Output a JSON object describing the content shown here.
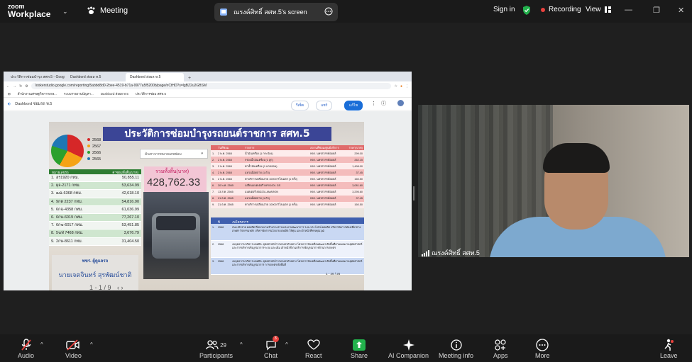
{
  "app": {
    "logo_line1": "zoom",
    "logo_line2": "Workplace",
    "meeting_label": "Meeting",
    "screen_tab_title": "ณรงค์ศิทธิ์ สศท.5's screen",
    "sign_in": "Sign in",
    "recording": "Recording",
    "view": "View"
  },
  "browser": {
    "tabs": [
      "ประวัติการซ่อมบำรุง สศท.5 - Google",
      "Dashbord ส่งผล ท.5",
      "Dashbord ส่งผล ท.5"
    ],
    "url": "lookerstudio.google.com/reporting/5abbd8d0-2bee-4519-b71a-9977a5f5200b/page/nCtHD?s=lgBZ2u2GBSM",
    "bookmarks": [
      "สำนักงานเศรษฐกิจการเกษ...",
      "ระบบรายงานปัญหา...",
      "Dashbord ส่งผล ท.5",
      "ประวัติการซ่อม สศท.5"
    ],
    "report_name": "Dashbord ซ่อมรถ ท.5",
    "reset_label": "รีเซ็ต",
    "share_label": "แชร์",
    "edit_label": "แก้ไข"
  },
  "report": {
    "title": "ประวัติการซ่อมบำรุงรถยนต์ราชการ สศท.5",
    "legend": [
      {
        "label": "2568",
        "color": "#d62728"
      },
      {
        "label": "2567",
        "color": "#f5a316"
      },
      {
        "label": "2566",
        "color": "#2ca02c"
      },
      {
        "label": "2565",
        "color": "#1f77b4"
      }
    ],
    "filter_label": "ค้นหาจากหมายเลขซ่อม",
    "total_label": "รวมทั้งสิ้น(บาท)",
    "total_value": "428,762.33",
    "left_table": {
      "headers": [
        "หมายเลขรถ",
        "ค่าซ่อมทั้งสิ้น(บาท)"
      ],
      "rows": [
        {
          "no": "1.",
          "name": "ฮร1920 กทม.",
          "amount": "50,855.11"
        },
        {
          "no": "2.",
          "name": "ผุจ-2171 กทม.",
          "amount": "53,634.99"
        },
        {
          "no": "3.",
          "name": "ฒฉ-6368 กทม.",
          "amount": "42,618.10"
        },
        {
          "no": "4.",
          "name": "9กต 2237 กทม.",
          "amount": "54,816.90"
        },
        {
          "no": "5.",
          "name": "6กฉ-4358 กทม.",
          "amount": "61,036.99"
        },
        {
          "no": "6.",
          "name": "6กษ-6019 กทม.",
          "amount": "77,267.10"
        },
        {
          "no": "7.",
          "name": "6กฆ-6017 กทม.",
          "amount": "53,451.85"
        },
        {
          "no": "8.",
          "name": "5ฆฬ 7468 กทม.",
          "amount": "3,676.79"
        },
        {
          "no": "9.",
          "name": "2กษ-8611 กทม.",
          "amount": "31,404.50"
        }
      ]
    },
    "officer_position": "พขร. ผู้ดูแลรถ",
    "officer_name": "นายเจตจินทร์ สุรพัฒน์ชาติ",
    "pager": "1 - 1 / 9",
    "work_table": {
      "headers": [
        "",
        "วันที่ซ่อม",
        "รายการ",
        "สถานที่ซ่อม/ศูนย์บริการ",
        "ราคา(บาท)"
      ],
      "rows": [
        {
          "no": "1.",
          "date": "2 พ.ค. 2565",
          "item": "น้ำมันเครื่อง (1 กระป๋อง)",
          "place": "หจก. นครสวรรค์ออยล์",
          "price": "299.00"
        },
        {
          "no": "2.",
          "date": "2 พ.ค. 2565",
          "item": "กรองน้ำมันเครื่อง (1 ลูก)",
          "place": "หจก. นครสวรรค์ออยล์",
          "price": "262.15"
        },
        {
          "no": "3.",
          "date": "2 พ.ค. 2565",
          "item": "ค่าน้ำมันเครื่อง (1 แกลลอน)",
          "place": "หจก. นครสวรรค์ออยล์",
          "price": "1,498.00"
        },
        {
          "no": "4.",
          "date": "2 พ.ค. 2565",
          "item": "แหวนน็อตถ่าย (1 ตัว)",
          "place": "หจก. นครสวรรค์ออยล์",
          "price": "37.45"
        },
        {
          "no": "5.",
          "date": "2 พ.ค. 2565",
          "item": "ค่าบริการเปลี่ยนถ่าย 10000 กิโลเมตร (1 ครั้ง)",
          "place": "หจก. นครสวรรค์ออยล์",
          "price": "160.50"
        },
        {
          "no": "6.",
          "date": "30 พ.ค. 2565",
          "item": "เปลี่ยนแบตเตอรี่ MFX100L GS",
          "place": "หจก. นครสวรรค์ออยล์",
          "price": "3,081.60"
        },
        {
          "no": "7.",
          "date": "13 ส.ค. 2565",
          "item": "แบตเตอรี่ 85D23L AMARON",
          "place": "หจก. นครสวรรค์ออยล์",
          "price": "3,295.60"
        },
        {
          "no": "8.",
          "date": "21 ต.ค. 2565",
          "item": "แหวนน็อตถ่าย (1 ตัว)",
          "place": "หจก. นครสวรรค์ออยล์",
          "price": "37.45"
        },
        {
          "no": "9.",
          "date": "21 ต.ค. 2565",
          "item": "ค่าบริการเปลี่ยนถ่าย 10000 กิโลเมตร (1 ครั้ง)",
          "place": "หจก. นครสวรรค์ออยล์",
          "price": "160.50"
        }
      ]
    },
    "plan_table": {
      "headers": [
        "",
        "ปี",
        "งบโครงการ"
      ],
      "rows": [
        {
          "no": "1.",
          "year": "2568",
          "text": "สนง.เบิกจ่าย ผลผลิต ที่หน่วยงานข้างกระทรวงแรงงานพัฒนาการ ระยะประโยชน์ ผลผลิต บริหารจัดการท่องเที่ยวทางเกษตร กิจกรรมหลัก บริหารจัดการนโยบาย ผลผลิต ให้ทุน และเจ้าหน้าที่ทรงคุณวุฒิ"
        },
        {
          "no": "2.",
          "year": "2568",
          "text": "งบบุคลากร/บริหาร ผลผลิต: ยุทธศาสตร์การเกษตรตัวอย่าง โครงการขับเคลื่อนพัฒนาเชิงพื้นที่ตามแผนงานยุทธศาสตร์ และการบริหารเชิงบูรณาการระบบ และเพิ่ม เจ้าหน้าที่งานบริการเชิงบูรณาการด้านการเกษตร"
        },
        {
          "no": "3.",
          "year": "2568",
          "text": "งบบุคลากร/บริหาร ผลผลิต: ยุทธศาสตร์การเกษตรตัวอย่าง โครงการขับเคลื่อนพัฒนาเชิงพื้นที่ตามแผนงานยุทธศาสตร์ และการบริหารเชิงบูรณาการ การเกษตรเชิงพื้นที่"
        }
      ],
      "pager": "1 - 26 / 26"
    }
  },
  "video": {
    "participant_name": "ณรงค์ศิทธิ์ สศท.5"
  },
  "toolbar": {
    "audio": "Audio",
    "video": "Video",
    "participants": "Participants",
    "participants_count": "29",
    "chat": "Chat",
    "chat_badge": "3",
    "react": "React",
    "share": "Share",
    "ai_companion": "AI Companion",
    "meeting_info": "Meeting info",
    "apps": "Apps",
    "more": "More",
    "leave": "Leave"
  },
  "colors": {
    "accent_green": "#22b14c",
    "recording_red": "#e8413d",
    "report_title_blue": "#3b4596"
  }
}
